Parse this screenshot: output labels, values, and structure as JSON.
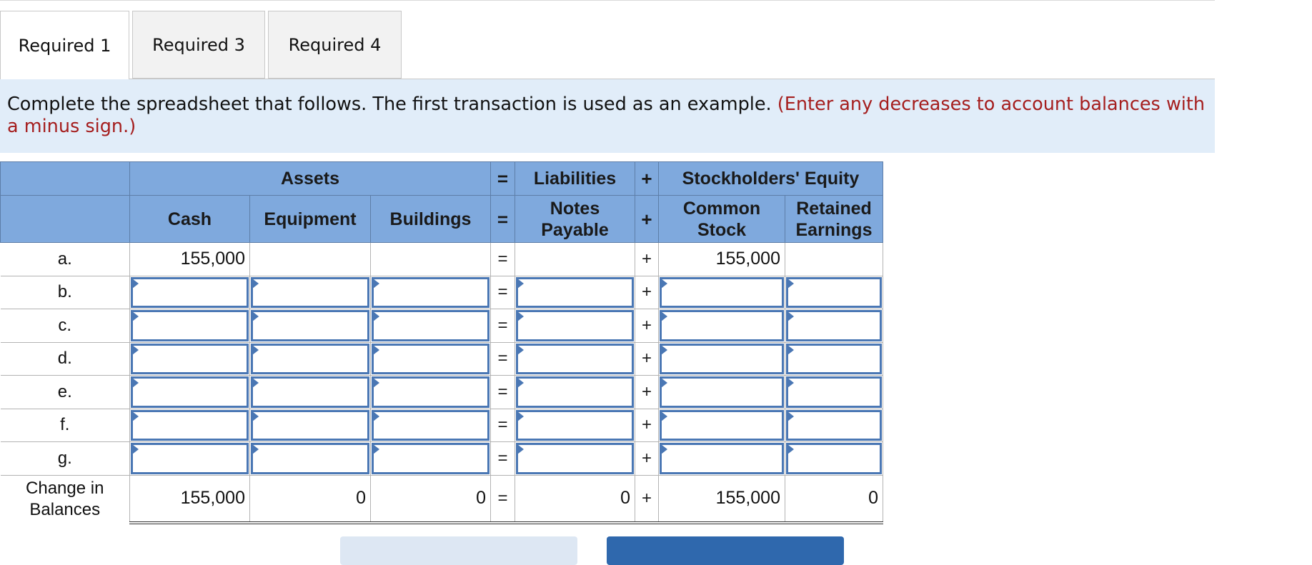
{
  "tabs": [
    {
      "label": "Required 1",
      "active": true
    },
    {
      "label": "Required 3",
      "active": false
    },
    {
      "label": "Required 4",
      "active": false
    }
  ],
  "instructions": {
    "text": "Complete the spreadsheet that follows. The first transaction is used as an example.",
    "hint": "(Enter any decreases to account balances with a minus sign.)"
  },
  "sheet": {
    "group_headers": {
      "assets": "Assets",
      "equals": "=",
      "liabilities": "Liabilities",
      "plus": "+",
      "equity": "Stockholders' Equity"
    },
    "columns": {
      "cash": "Cash",
      "equipment": "Equipment",
      "buildings": "Buildings",
      "equals": "=",
      "notes_payable": "Notes Payable",
      "plus": "+",
      "common_stock": "Common Stock",
      "retained_earnings": "Retained Earnings"
    },
    "rows": [
      {
        "label": "a.",
        "cash": "155,000",
        "equipment": "",
        "buildings": "",
        "eq": "=",
        "notes_payable": "",
        "plus": "+",
        "common_stock": "155,000",
        "retained_earnings": ""
      },
      {
        "label": "b.",
        "eq": "=",
        "plus": "+"
      },
      {
        "label": "c.",
        "eq": "=",
        "plus": "+"
      },
      {
        "label": "d.",
        "eq": "=",
        "plus": "+"
      },
      {
        "label": "e.",
        "eq": "=",
        "plus": "+"
      },
      {
        "label": "f.",
        "eq": "=",
        "plus": "+"
      },
      {
        "label": "g.",
        "eq": "=",
        "plus": "+"
      }
    ],
    "totals": {
      "label": "Change in Balances",
      "cash": "155,000",
      "equipment": "0",
      "buildings": "0",
      "eq": "=",
      "notes_payable": "0",
      "plus": "+",
      "common_stock": "155,000",
      "retained_earnings": "0"
    }
  },
  "colors": {
    "header_blue": "#7fa9dd",
    "instruction_band": "#e1edf9",
    "hint_red": "#a51e1e",
    "input_border": "#4a77b4",
    "next_button": "#2f68ad",
    "prev_button": "#dde7f3"
  }
}
